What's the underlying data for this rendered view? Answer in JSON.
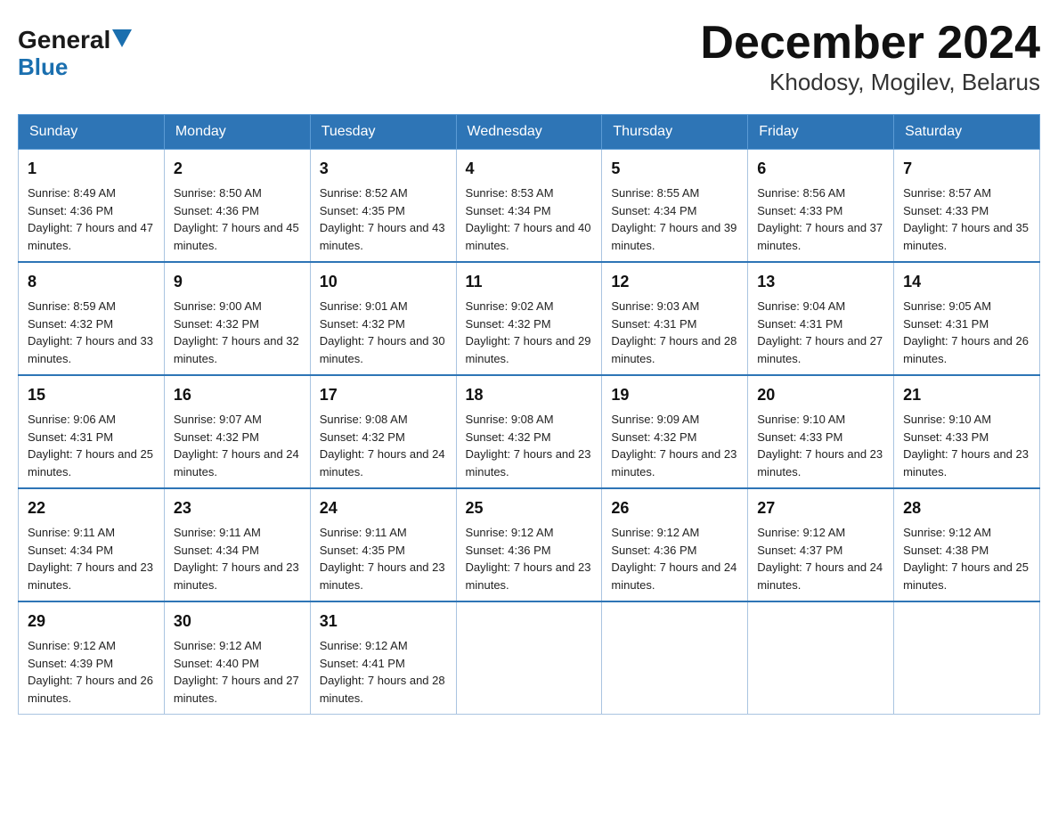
{
  "header": {
    "logo_line1": "General",
    "logo_line2": "Blue",
    "title": "December 2024",
    "subtitle": "Khodosy, Mogilev, Belarus"
  },
  "days_of_week": [
    "Sunday",
    "Monday",
    "Tuesday",
    "Wednesday",
    "Thursday",
    "Friday",
    "Saturday"
  ],
  "weeks": [
    [
      {
        "date": "1",
        "sunrise": "8:49 AM",
        "sunset": "4:36 PM",
        "daylight": "7 hours and 47 minutes."
      },
      {
        "date": "2",
        "sunrise": "8:50 AM",
        "sunset": "4:36 PM",
        "daylight": "7 hours and 45 minutes."
      },
      {
        "date": "3",
        "sunrise": "8:52 AM",
        "sunset": "4:35 PM",
        "daylight": "7 hours and 43 minutes."
      },
      {
        "date": "4",
        "sunrise": "8:53 AM",
        "sunset": "4:34 PM",
        "daylight": "7 hours and 40 minutes."
      },
      {
        "date": "5",
        "sunrise": "8:55 AM",
        "sunset": "4:34 PM",
        "daylight": "7 hours and 39 minutes."
      },
      {
        "date": "6",
        "sunrise": "8:56 AM",
        "sunset": "4:33 PM",
        "daylight": "7 hours and 37 minutes."
      },
      {
        "date": "7",
        "sunrise": "8:57 AM",
        "sunset": "4:33 PM",
        "daylight": "7 hours and 35 minutes."
      }
    ],
    [
      {
        "date": "8",
        "sunrise": "8:59 AM",
        "sunset": "4:32 PM",
        "daylight": "7 hours and 33 minutes."
      },
      {
        "date": "9",
        "sunrise": "9:00 AM",
        "sunset": "4:32 PM",
        "daylight": "7 hours and 32 minutes."
      },
      {
        "date": "10",
        "sunrise": "9:01 AM",
        "sunset": "4:32 PM",
        "daylight": "7 hours and 30 minutes."
      },
      {
        "date": "11",
        "sunrise": "9:02 AM",
        "sunset": "4:32 PM",
        "daylight": "7 hours and 29 minutes."
      },
      {
        "date": "12",
        "sunrise": "9:03 AM",
        "sunset": "4:31 PM",
        "daylight": "7 hours and 28 minutes."
      },
      {
        "date": "13",
        "sunrise": "9:04 AM",
        "sunset": "4:31 PM",
        "daylight": "7 hours and 27 minutes."
      },
      {
        "date": "14",
        "sunrise": "9:05 AM",
        "sunset": "4:31 PM",
        "daylight": "7 hours and 26 minutes."
      }
    ],
    [
      {
        "date": "15",
        "sunrise": "9:06 AM",
        "sunset": "4:31 PM",
        "daylight": "7 hours and 25 minutes."
      },
      {
        "date": "16",
        "sunrise": "9:07 AM",
        "sunset": "4:32 PM",
        "daylight": "7 hours and 24 minutes."
      },
      {
        "date": "17",
        "sunrise": "9:08 AM",
        "sunset": "4:32 PM",
        "daylight": "7 hours and 24 minutes."
      },
      {
        "date": "18",
        "sunrise": "9:08 AM",
        "sunset": "4:32 PM",
        "daylight": "7 hours and 23 minutes."
      },
      {
        "date": "19",
        "sunrise": "9:09 AM",
        "sunset": "4:32 PM",
        "daylight": "7 hours and 23 minutes."
      },
      {
        "date": "20",
        "sunrise": "9:10 AM",
        "sunset": "4:33 PM",
        "daylight": "7 hours and 23 minutes."
      },
      {
        "date": "21",
        "sunrise": "9:10 AM",
        "sunset": "4:33 PM",
        "daylight": "7 hours and 23 minutes."
      }
    ],
    [
      {
        "date": "22",
        "sunrise": "9:11 AM",
        "sunset": "4:34 PM",
        "daylight": "7 hours and 23 minutes."
      },
      {
        "date": "23",
        "sunrise": "9:11 AM",
        "sunset": "4:34 PM",
        "daylight": "7 hours and 23 minutes."
      },
      {
        "date": "24",
        "sunrise": "9:11 AM",
        "sunset": "4:35 PM",
        "daylight": "7 hours and 23 minutes."
      },
      {
        "date": "25",
        "sunrise": "9:12 AM",
        "sunset": "4:36 PM",
        "daylight": "7 hours and 23 minutes."
      },
      {
        "date": "26",
        "sunrise": "9:12 AM",
        "sunset": "4:36 PM",
        "daylight": "7 hours and 24 minutes."
      },
      {
        "date": "27",
        "sunrise": "9:12 AM",
        "sunset": "4:37 PM",
        "daylight": "7 hours and 24 minutes."
      },
      {
        "date": "28",
        "sunrise": "9:12 AM",
        "sunset": "4:38 PM",
        "daylight": "7 hours and 25 minutes."
      }
    ],
    [
      {
        "date": "29",
        "sunrise": "9:12 AM",
        "sunset": "4:39 PM",
        "daylight": "7 hours and 26 minutes."
      },
      {
        "date": "30",
        "sunrise": "9:12 AM",
        "sunset": "4:40 PM",
        "daylight": "7 hours and 27 minutes."
      },
      {
        "date": "31",
        "sunrise": "9:12 AM",
        "sunset": "4:41 PM",
        "daylight": "7 hours and 28 minutes."
      },
      null,
      null,
      null,
      null
    ]
  ]
}
